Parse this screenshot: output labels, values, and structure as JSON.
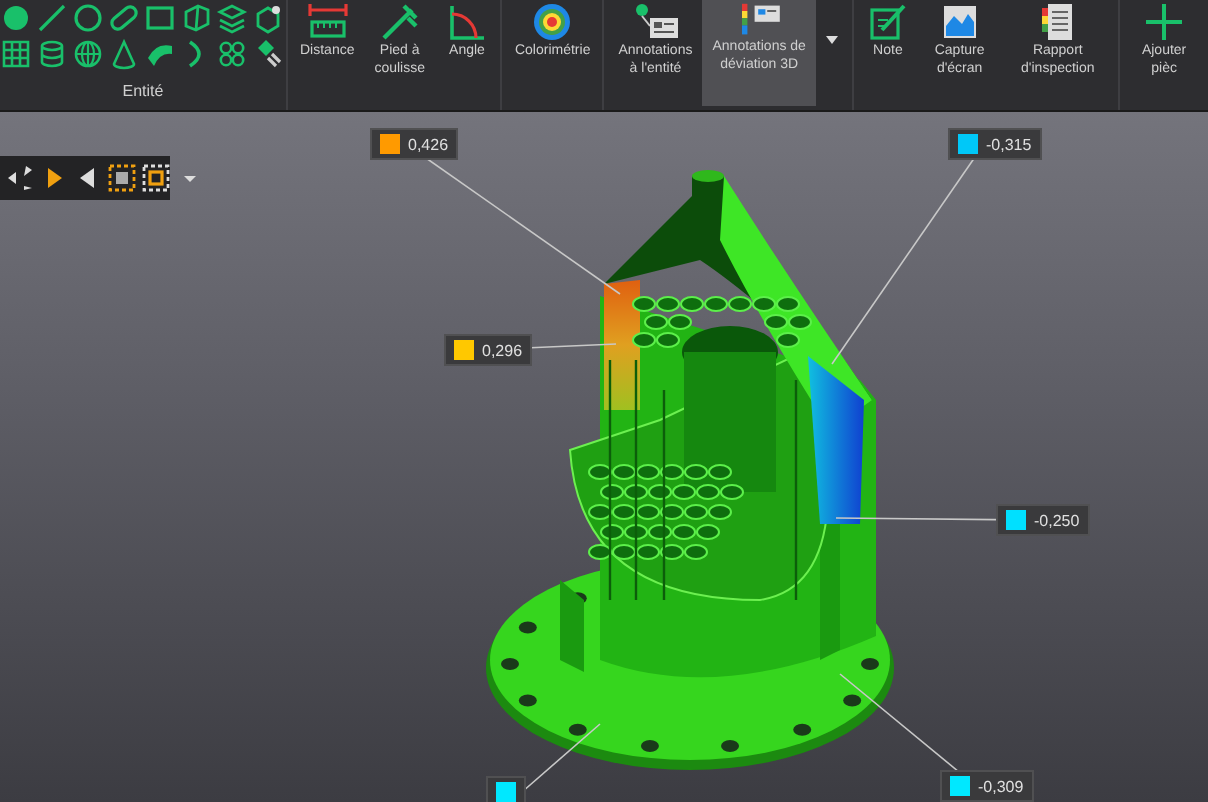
{
  "ribbon": {
    "entity_group": {
      "label": "Entité"
    },
    "groups": [
      {
        "buttons": [
          {
            "kind": "distance",
            "label": "Distance",
            "selected": false
          },
          {
            "kind": "caliper",
            "label": "Pied à coulisse",
            "selected": false
          },
          {
            "kind": "angle",
            "label": "Angle",
            "selected": false
          }
        ]
      },
      {
        "buttons": [
          {
            "kind": "colormap",
            "label": "Colorimétrie",
            "selected": false
          }
        ]
      },
      {
        "buttons": [
          {
            "kind": "entitynote",
            "label": "Annotations à l'entité",
            "selected": false
          },
          {
            "kind": "deviationnote",
            "label": "Annotations de déviation 3D",
            "selected": true
          },
          {
            "kind": "dropdown",
            "selected": false
          }
        ]
      },
      {
        "buttons": [
          {
            "kind": "note",
            "label": "Note",
            "selected": false
          },
          {
            "kind": "capture",
            "label": "Capture d'écran",
            "selected": false
          },
          {
            "kind": "report",
            "label": "Rapport d'inspection",
            "selected": false
          }
        ]
      },
      {
        "buttons": [
          {
            "kind": "add",
            "label": "Ajouter pièc",
            "selected": false
          }
        ]
      }
    ]
  },
  "annotations": [
    {
      "value": "0,426",
      "color": "#ff9a00"
    },
    {
      "value": "0,296",
      "color": "#ffc800"
    },
    {
      "value": "-0,315",
      "color": "#00c8f8"
    },
    {
      "value": "-0,250",
      "color": "#00e0ff"
    },
    {
      "value": "-0,309",
      "color": "#00e8ff"
    },
    {
      "color": "#00e8ff"
    }
  ]
}
